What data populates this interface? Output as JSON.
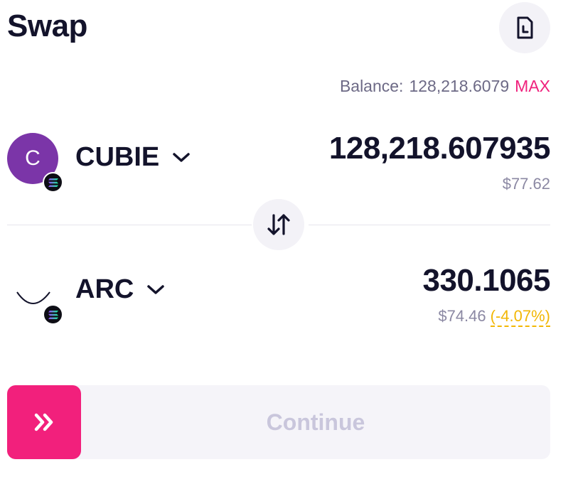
{
  "header": {
    "title": "Swap",
    "history_icon": "history-document-icon"
  },
  "balance": {
    "label": "Balance:",
    "value": "128,218.6079",
    "max_label": "MAX"
  },
  "from_token": {
    "icon_letter": "C",
    "symbol": "CUBIE",
    "amount": "128,218.607935",
    "usd_value": "$77.62",
    "chain_icon": "solana-icon"
  },
  "to_token": {
    "symbol": "ARC",
    "amount": "330.1065",
    "usd_value": "$74.46",
    "price_impact": "(-4.07%)",
    "chain_icon": "solana-icon"
  },
  "action": {
    "continue_label": "Continue",
    "handle_icon": "double-chevron-right-icon"
  },
  "colors": {
    "accent": "#f2207c",
    "warning": "#f2b705",
    "text": "#13132b",
    "muted": "#8b88a3"
  }
}
